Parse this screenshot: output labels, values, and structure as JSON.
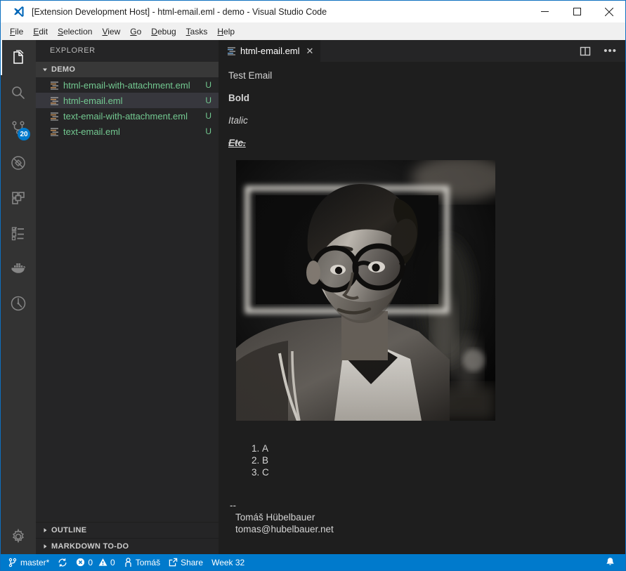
{
  "window": {
    "title": "[Extension Development Host] - html-email.eml - demo - Visual Studio Code",
    "logo_icon": "vscode-logo-icon",
    "controls": [
      {
        "name": "minimize-button",
        "icon": "minimize-icon"
      },
      {
        "name": "maximize-button",
        "icon": "maximize-icon"
      },
      {
        "name": "close-button",
        "icon": "close-icon"
      }
    ]
  },
  "menubar": {
    "items": [
      {
        "label": "File",
        "mnemonic": "F",
        "rest": "ile"
      },
      {
        "label": "Edit",
        "mnemonic": "E",
        "rest": "dit"
      },
      {
        "label": "Selection",
        "mnemonic": "S",
        "rest": "election"
      },
      {
        "label": "View",
        "mnemonic": "V",
        "rest": "iew"
      },
      {
        "label": "Go",
        "mnemonic": "G",
        "rest": "o"
      },
      {
        "label": "Debug",
        "mnemonic": "D",
        "rest": "ebug"
      },
      {
        "label": "Tasks",
        "mnemonic": "T",
        "rest": "asks"
      },
      {
        "label": "Help",
        "mnemonic": "H",
        "rest": "elp"
      }
    ]
  },
  "activitybar": {
    "items": [
      {
        "name": "activity-explorer",
        "icon": "files-icon",
        "active": true,
        "badge": ""
      },
      {
        "name": "activity-search",
        "icon": "search-icon",
        "active": false,
        "badge": ""
      },
      {
        "name": "activity-source-control",
        "icon": "source-control-icon",
        "active": false,
        "badge": "20"
      },
      {
        "name": "activity-debug",
        "icon": "debug-icon",
        "active": false,
        "badge": ""
      },
      {
        "name": "activity-extensions",
        "icon": "extensions-icon",
        "active": false,
        "badge": ""
      },
      {
        "name": "activity-todo",
        "icon": "checklist-icon",
        "active": false,
        "badge": ""
      },
      {
        "name": "activity-docker",
        "icon": "docker-icon",
        "active": false,
        "badge": ""
      },
      {
        "name": "activity-git-graph",
        "icon": "git-graph-icon",
        "active": false,
        "badge": ""
      }
    ],
    "settings": {
      "name": "activity-settings",
      "icon": "gear-icon"
    }
  },
  "sidebar": {
    "title": "EXPLORER",
    "folder": {
      "label": "DEMO",
      "expanded": true
    },
    "files": [
      {
        "name": "html-email-with-attachment.eml",
        "status": "U",
        "selected": false
      },
      {
        "name": "html-email.eml",
        "status": "U",
        "selected": true
      },
      {
        "name": "text-email-with-attachment.eml",
        "status": "U",
        "selected": false
      },
      {
        "name": "text-email.eml",
        "status": "U",
        "selected": false
      }
    ],
    "sections": [
      {
        "label": "OUTLINE",
        "expanded": false
      },
      {
        "label": "MARKDOWN TO-DO",
        "expanded": false
      }
    ]
  },
  "editor": {
    "tabs": [
      {
        "label": "html-email.eml",
        "active": true,
        "close_label": "✕",
        "icon": "eml-file-icon"
      }
    ],
    "actions": [
      {
        "name": "split-editor-button",
        "icon": "split-editor-icon"
      },
      {
        "name": "more-actions-button",
        "icon": "ellipsis-icon",
        "label": "•••"
      }
    ]
  },
  "mail": {
    "subject": "Test Email",
    "bold_text": "Bold",
    "italic_text": "Italic",
    "etc_text": "Etc.",
    "image_alt": "black-and-white portrait photo",
    "list": [
      "A",
      "B",
      "C"
    ],
    "signature_separator": "--",
    "signature_name": "Tomáš Hübelbauer",
    "signature_email": "tomas@hubelbauer.net"
  },
  "statusbar": {
    "branch": "master*",
    "sync_icon": "sync-icon",
    "errors": "0",
    "warnings": "0",
    "account": "Tomáš",
    "share": "Share",
    "week": "Week 32",
    "bell_icon": "bell-icon",
    "background": "#007acc"
  },
  "colors": {
    "accent": "#007acc",
    "editor_bg": "#1e1e1e",
    "sidebar_bg": "#252526",
    "activitybar_bg": "#333333",
    "file_green": "#73c991",
    "selected_row": "#37373d",
    "titlebar_bg": "#ffffff"
  }
}
